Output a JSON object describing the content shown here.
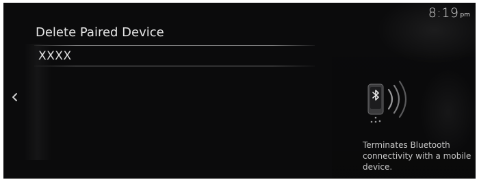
{
  "status_bar": {
    "time": "8:19",
    "ampm": "pm"
  },
  "screen": {
    "title": "Delete Paired Device",
    "devices": [
      {
        "name": "XXXX"
      }
    ],
    "description": "Terminates Bluetooth connectivity with a mobile device."
  },
  "icons": {
    "back": "chevron-left-icon",
    "illustration": "bluetooth-phone-disconnect-icon"
  },
  "colors": {
    "background": "#0b0b0c",
    "text": "#e6e6e6",
    "muted_text": "#c8c8c8"
  }
}
